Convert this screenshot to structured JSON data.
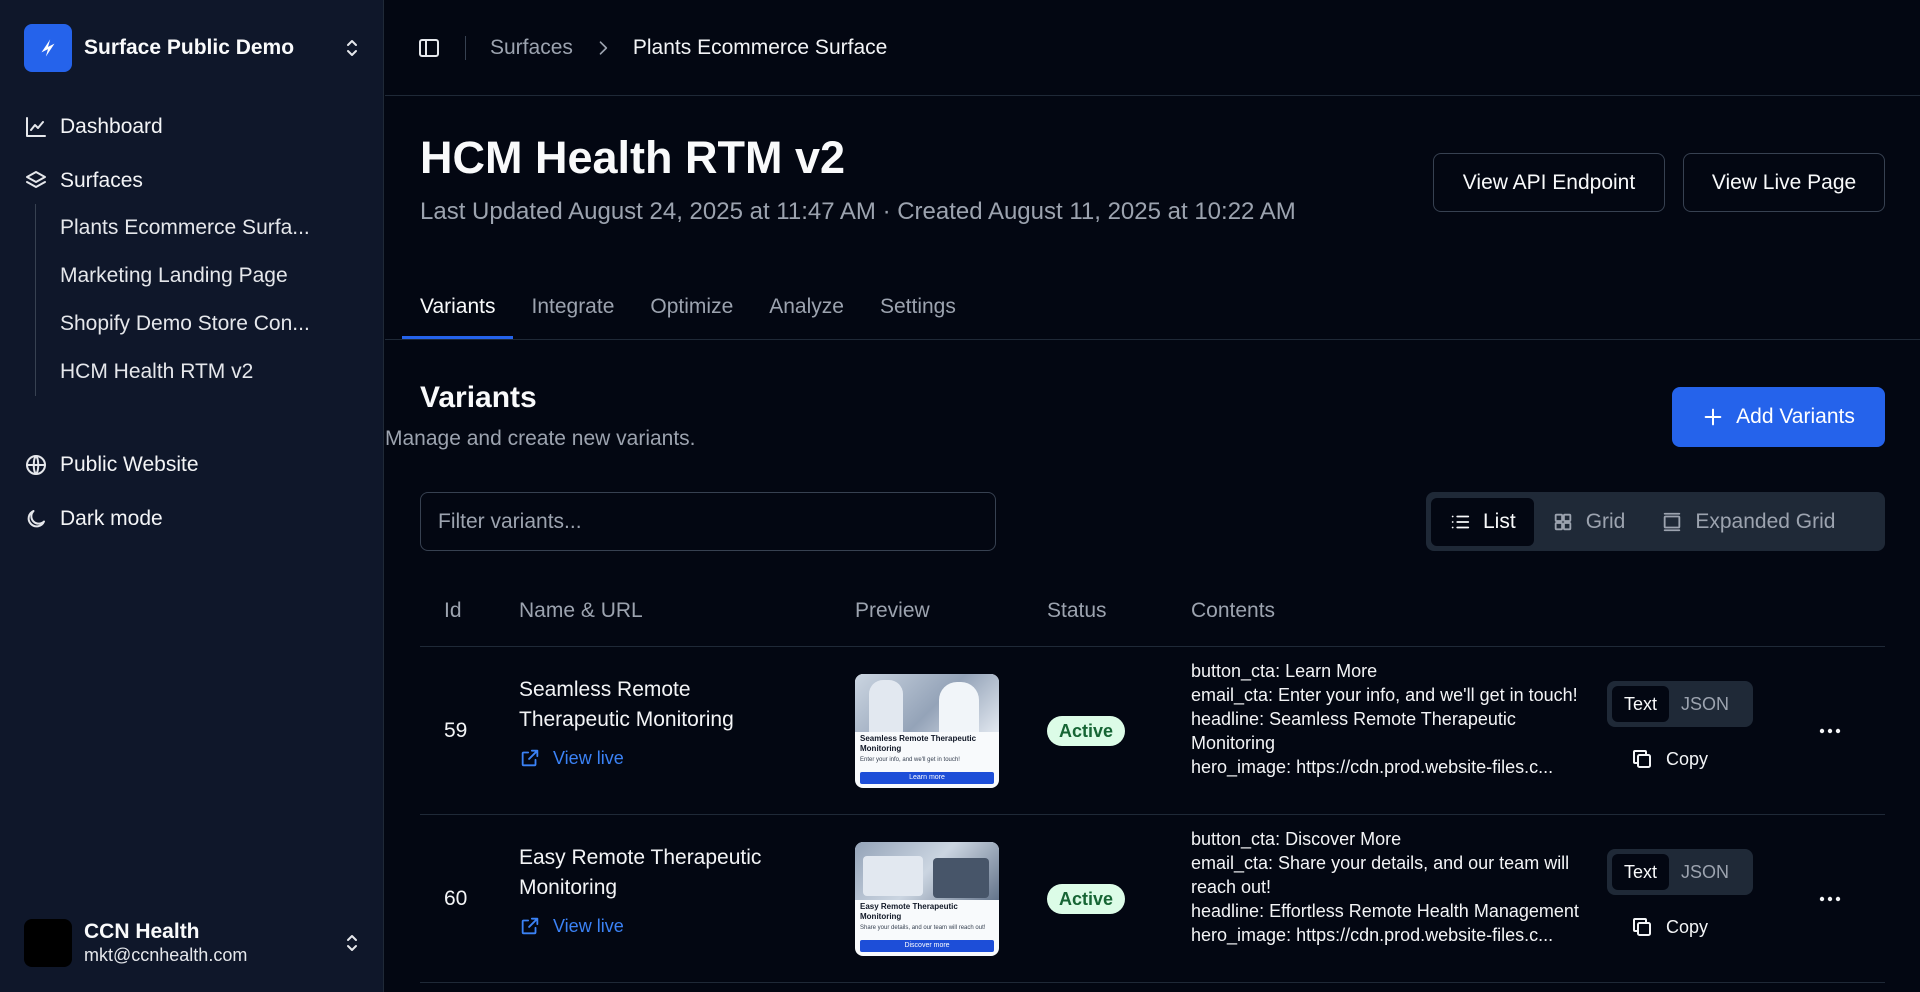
{
  "workspace": {
    "name": "Surface Public Demo"
  },
  "sidebar": {
    "nav": [
      {
        "label": "Dashboard",
        "icon": "chart-line-icon"
      },
      {
        "label": "Surfaces",
        "icon": "layers-icon"
      }
    ],
    "surfaces": [
      "Plants Ecommerce Surfa...",
      "Marketing Landing Page",
      "Shopify Demo Store Con...",
      "HCM Health RTM v2"
    ],
    "extra": [
      {
        "label": "Public Website",
        "icon": "globe-icon"
      },
      {
        "label": "Dark mode",
        "icon": "moon-icon"
      }
    ]
  },
  "user": {
    "name": "CCN Health",
    "email": "mkt@ccnhealth.com"
  },
  "breadcrumb": {
    "parent": "Surfaces",
    "current": "Plants Ecommerce Surface"
  },
  "page": {
    "title": "HCM Health RTM v2",
    "subtitle": "Last Updated August 24, 2025 at 11:47 AM · Created August 11, 2025 at 10:22 AM",
    "api_button": "View API Endpoint",
    "live_button": "View Live Page"
  },
  "tabs": [
    "Variants",
    "Integrate",
    "Optimize",
    "Analyze",
    "Settings"
  ],
  "variants": {
    "title": "Variants",
    "subtitle": "Manage and create new variants.",
    "add_button": "Add Variants",
    "filter_placeholder": "Filter variants...",
    "views": [
      "List",
      "Grid",
      "Expanded Grid"
    ],
    "columns": [
      "Id",
      "Name & URL",
      "Preview",
      "Status",
      "Contents"
    ],
    "view_live_label": "View live",
    "format_text": "Text",
    "format_json": "JSON",
    "copy_label": "Copy",
    "rows": [
      {
        "id": "59",
        "name": "Seamless Remote Therapeutic Monitoring",
        "status": "Active",
        "preview_title": "Seamless Remote Therapeutic Monitoring",
        "preview_text": "Enter your info, and we'll get in touch!",
        "preview_button": "Learn more",
        "contents": [
          "button_cta: Learn More",
          "email_cta: Enter your info, and we'll get in touch!",
          "headline: Seamless Remote Therapeutic Monitoring",
          "hero_image: https://cdn.prod.website-files.c..."
        ]
      },
      {
        "id": "60",
        "name": "Easy Remote Therapeutic Monitoring",
        "status": "Active",
        "preview_title": "Easy Remote Therapeutic Monitoring",
        "preview_text": "Share your details, and our team will reach out!",
        "preview_button": "Discover more",
        "contents": [
          "button_cta: Discover More",
          "email_cta: Share your details, and our team will reach out!",
          "headline: Effortless Remote Health Management",
          "hero_image: https://cdn.prod.website-files.c..."
        ]
      }
    ]
  },
  "colors": {
    "accent": "#2563eb",
    "background": "#030712",
    "sidebar": "#0f172a",
    "active_badge": "#dcfce7"
  }
}
